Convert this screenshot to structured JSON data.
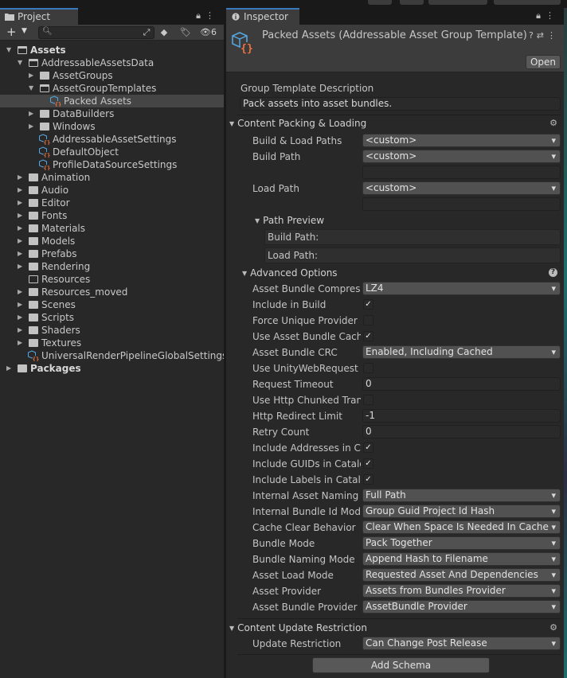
{
  "project": {
    "tab_label": "Project",
    "search_placeholder": "",
    "hidden_count": "6",
    "tree": [
      {
        "label": "Assets",
        "depth": 0,
        "arrow": "down",
        "icon": "folder-open",
        "bold": true
      },
      {
        "label": "AddressableAssetsData",
        "depth": 1,
        "arrow": "down",
        "icon": "folder-open"
      },
      {
        "label": "AssetGroups",
        "depth": 2,
        "arrow": "right",
        "icon": "folder"
      },
      {
        "label": "AssetGroupTemplates",
        "depth": 2,
        "arrow": "down",
        "icon": "folder-open"
      },
      {
        "label": "Packed Assets",
        "depth": 3,
        "arrow": "",
        "icon": "asset",
        "selected": true
      },
      {
        "label": "DataBuilders",
        "depth": 2,
        "arrow": "right",
        "icon": "folder"
      },
      {
        "label": "Windows",
        "depth": 2,
        "arrow": "right",
        "icon": "folder"
      },
      {
        "label": "AddressableAssetSettings",
        "depth": 2,
        "arrow": "",
        "icon": "asset"
      },
      {
        "label": "DefaultObject",
        "depth": 2,
        "arrow": "",
        "icon": "asset"
      },
      {
        "label": "ProfileDataSourceSettings",
        "depth": 2,
        "arrow": "",
        "icon": "asset"
      },
      {
        "label": "Animation",
        "depth": 1,
        "arrow": "right",
        "icon": "folder"
      },
      {
        "label": "Audio",
        "depth": 1,
        "arrow": "right",
        "icon": "folder"
      },
      {
        "label": "Editor",
        "depth": 1,
        "arrow": "right",
        "icon": "folder"
      },
      {
        "label": "Fonts",
        "depth": 1,
        "arrow": "right",
        "icon": "folder"
      },
      {
        "label": "Materials",
        "depth": 1,
        "arrow": "right",
        "icon": "folder"
      },
      {
        "label": "Models",
        "depth": 1,
        "arrow": "right",
        "icon": "folder"
      },
      {
        "label": "Prefabs",
        "depth": 1,
        "arrow": "right",
        "icon": "folder"
      },
      {
        "label": "Rendering",
        "depth": 1,
        "arrow": "right",
        "icon": "folder"
      },
      {
        "label": "Resources",
        "depth": 1,
        "arrow": "",
        "icon": "folder-empty"
      },
      {
        "label": "Resources_moved",
        "depth": 1,
        "arrow": "right",
        "icon": "folder"
      },
      {
        "label": "Scenes",
        "depth": 1,
        "arrow": "right",
        "icon": "folder"
      },
      {
        "label": "Scripts",
        "depth": 1,
        "arrow": "right",
        "icon": "folder"
      },
      {
        "label": "Shaders",
        "depth": 1,
        "arrow": "right",
        "icon": "folder"
      },
      {
        "label": "Textures",
        "depth": 1,
        "arrow": "right",
        "icon": "folder"
      },
      {
        "label": "UniversalRenderPipelineGlobalSettings",
        "depth": 1,
        "arrow": "",
        "icon": "asset"
      },
      {
        "label": "Packages",
        "depth": 0,
        "arrow": "right",
        "icon": "folder",
        "bold": true
      }
    ]
  },
  "inspector": {
    "tab_label": "Inspector",
    "title": "Packed Assets (Addressable Asset Group Template)",
    "open_label": "Open",
    "desc_label": "Group Template Description",
    "desc_value": "Pack assets into asset bundles.",
    "sec_content_packing": "Content Packing & Loading",
    "build_load_paths_label": "Build & Load Paths",
    "build_load_paths_value": "<custom>",
    "build_path_label": "Build Path",
    "build_path_value": "<custom>",
    "load_path_label": "Load Path",
    "load_path_value": "<custom>",
    "path_preview_label": "Path Preview",
    "preview_build": "Build Path:",
    "preview_load": "Load Path:",
    "advanced_label": "Advanced Options",
    "compression_label": "Asset Bundle Compression",
    "compression_value": "LZ4",
    "include_build_label": "Include in Build",
    "force_unique_label": "Force Unique Provider",
    "use_cache_label": "Use Asset Bundle Cache",
    "crc_label": "Asset Bundle CRC",
    "crc_value": "Enabled, Including Cached",
    "use_uwr_label": "Use UnityWebRequest for Local Asset Bundles",
    "timeout_label": "Request Timeout",
    "timeout_value": "0",
    "chunked_label": "Use Http Chunked Transfer",
    "redirect_label": "Http Redirect Limit",
    "redirect_value": "-1",
    "retry_label": "Retry Count",
    "retry_value": "0",
    "inc_addr_label": "Include Addresses in Catalog",
    "inc_guid_label": "Include GUIDs in Catalog",
    "inc_labels_label": "Include Labels in Catalog",
    "naming_label": "Internal Asset Naming Mode",
    "naming_value": "Full Path",
    "bundle_id_label": "Internal Bundle Id Mode",
    "bundle_id_value": "Group Guid Project Id Hash",
    "cache_clear_label": "Cache Clear Behavior",
    "cache_clear_value": "Clear When Space Is Needed In Cache",
    "bundle_mode_label": "Bundle Mode",
    "bundle_mode_value": "Pack Together",
    "bundle_naming_label": "Bundle Naming Mode",
    "bundle_naming_value": "Append Hash to Filename",
    "load_mode_label": "Asset Load Mode",
    "load_mode_value": "Requested Asset And Dependencies",
    "asset_provider_label": "Asset Provider",
    "asset_provider_value": "Assets from Bundles Provider",
    "bundle_provider_label": "Asset Bundle Provider",
    "bundle_provider_value": "AssetBundle Provider",
    "sec_update": "Content Update Restriction",
    "update_restriction_label": "Update Restriction",
    "update_restriction_value": "Can Change Post Release",
    "add_schema_label": "Add Schema",
    "check_mark": "✓"
  }
}
